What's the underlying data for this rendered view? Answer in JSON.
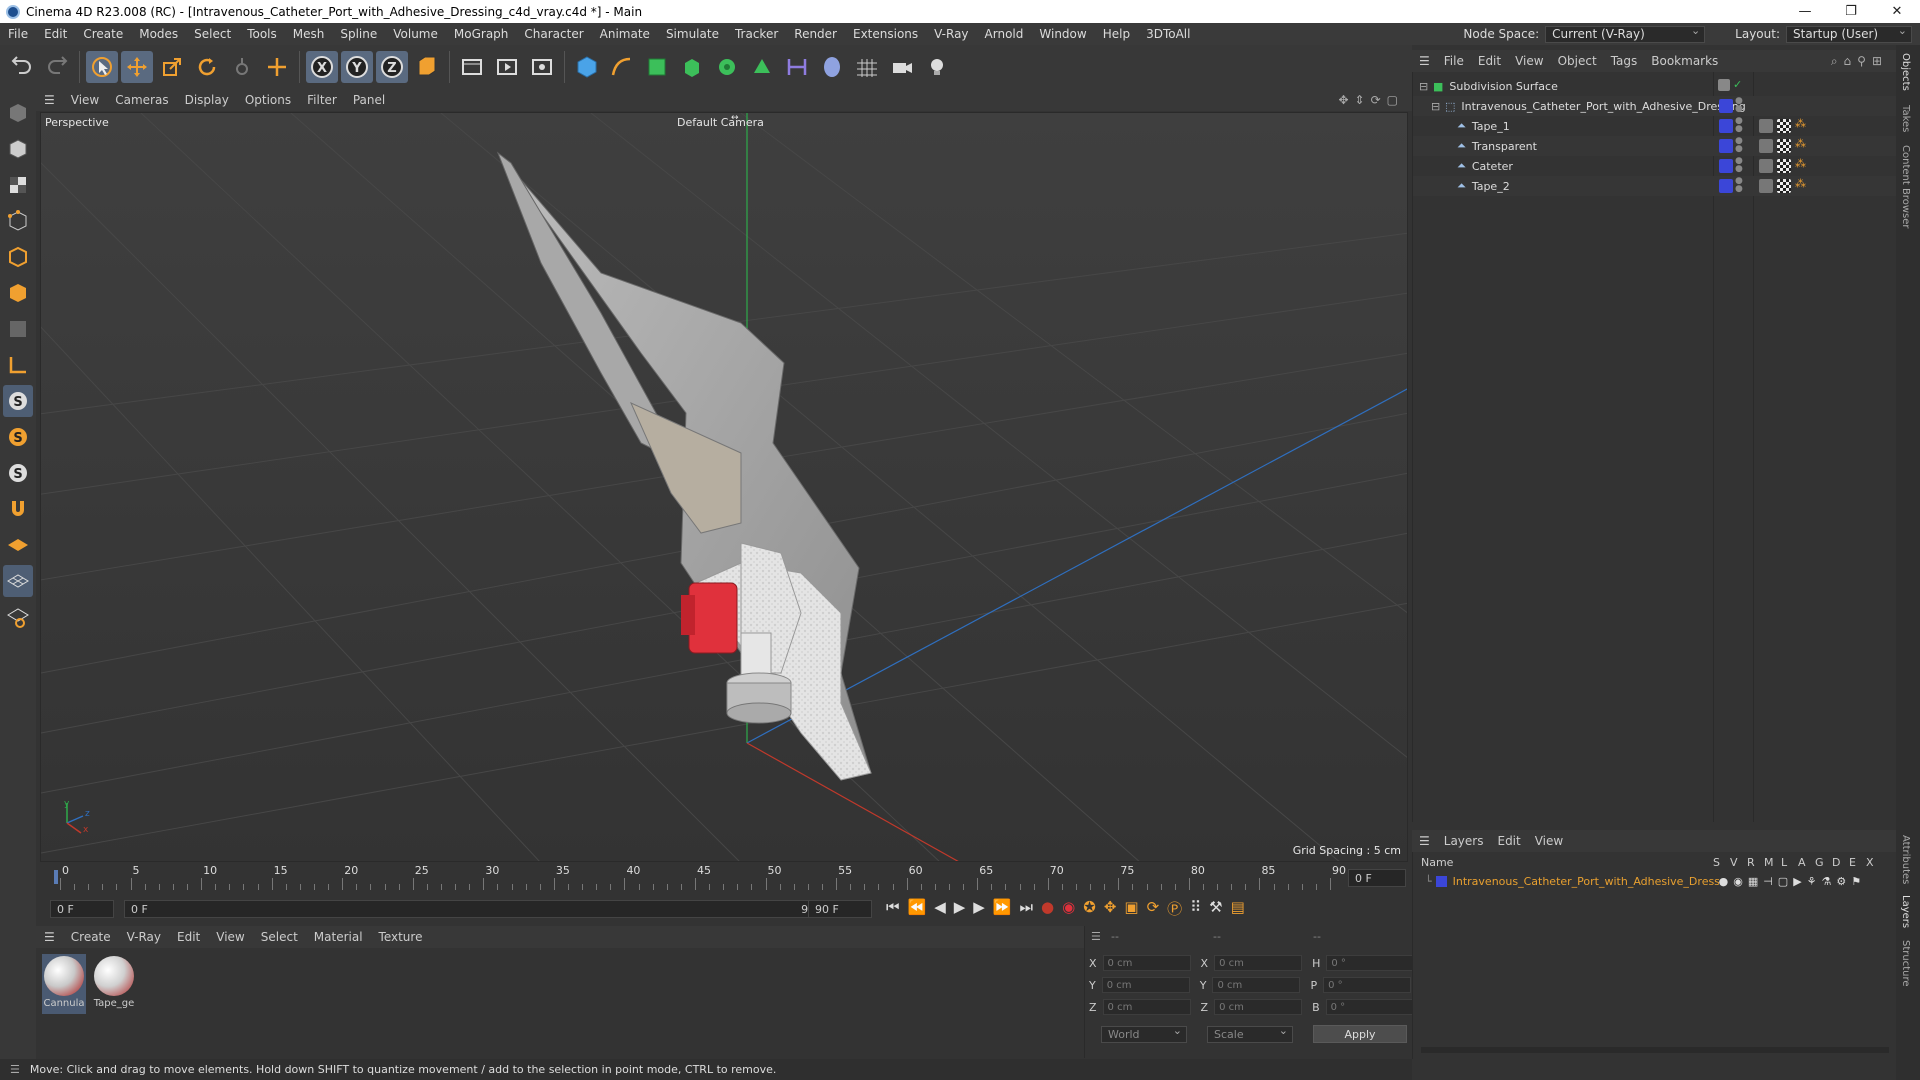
{
  "window": {
    "title": "Cinema 4D R23.008 (RC) - [Intravenous_Catheter_Port_with_Adhesive_Dressing_c4d_vray.c4d *] - Main",
    "controls": [
      "—",
      "❐",
      "✕"
    ]
  },
  "menubar": {
    "items": [
      "File",
      "Edit",
      "Create",
      "Modes",
      "Select",
      "Tools",
      "Mesh",
      "Spline",
      "Volume",
      "MoGraph",
      "Character",
      "Animate",
      "Simulate",
      "Tracker",
      "Render",
      "Extensions",
      "V-Ray",
      "Arnold",
      "Window",
      "Help",
      "3DToAll"
    ],
    "node_space_label": "Node Space:",
    "node_space_value": "Current (V-Ray)",
    "layout_label": "Layout:",
    "layout_value": "Startup (User)"
  },
  "viewport": {
    "menu": [
      "View",
      "Cameras",
      "Display",
      "Options",
      "Filter",
      "Panel"
    ],
    "view_name": "Perspective",
    "camera": "Default Camera",
    "grid_spacing": "Grid Spacing : 5 cm",
    "axis_labels": {
      "y": "y",
      "z": "z",
      "x": "x"
    }
  },
  "timeline": {
    "ticks": [
      "0",
      "5",
      "10",
      "15",
      "20",
      "25",
      "30",
      "35",
      "40",
      "45",
      "50",
      "55",
      "60",
      "65",
      "70",
      "75",
      "80",
      "85",
      "90"
    ],
    "current_frame_right": "0 F",
    "start_field": "0 F",
    "range_start": "0 F",
    "range_end": "90 F",
    "end_field": "90 F"
  },
  "material_manager": {
    "menu": [
      "Create",
      "V-Ray",
      "Edit",
      "View",
      "Select",
      "Material",
      "Texture"
    ],
    "materials": [
      {
        "name": "Cannula",
        "color": "#c9c9c9"
      },
      {
        "name": "Tape_ge",
        "color": "#d0d0d0"
      }
    ]
  },
  "coordinates": {
    "headers": [
      "--",
      "--",
      "--"
    ],
    "rows": [
      {
        "a": "X",
        "av": "0 cm",
        "b": "X",
        "bv": "0 cm",
        "c": "H",
        "cv": "0 °"
      },
      {
        "a": "Y",
        "av": "0 cm",
        "b": "Y",
        "bv": "0 cm",
        "c": "P",
        "cv": "0 °"
      },
      {
        "a": "Z",
        "av": "0 cm",
        "b": "Z",
        "bv": "0 cm",
        "c": "B",
        "cv": "0 °"
      }
    ],
    "mode1": "World",
    "mode2": "Scale",
    "apply": "Apply"
  },
  "status": {
    "text": "Move: Click and drag to move elements. Hold down SHIFT to quantize movement / add to the selection in point mode, CTRL to remove."
  },
  "object_manager": {
    "menu": [
      "File",
      "Edit",
      "View",
      "Object",
      "Tags",
      "Bookmarks"
    ],
    "objects": [
      {
        "name": "Subdivision Surface",
        "indent": 0
      },
      {
        "name": "Intravenous_Catheter_Port_with_Adhesive_Dressing",
        "indent": 1
      },
      {
        "name": "Tape_1",
        "indent": 2
      },
      {
        "name": "Transparent",
        "indent": 2
      },
      {
        "name": "Cateter",
        "indent": 2
      },
      {
        "name": "Tape_2",
        "indent": 2
      }
    ]
  },
  "layer_manager": {
    "menu": [
      "Layers",
      "Edit",
      "View"
    ],
    "columns": [
      "Name",
      "S",
      "V",
      "R",
      "M",
      "L",
      "A",
      "G",
      "D",
      "E",
      "X"
    ],
    "layer_name": "Intravenous_Catheter_Port_with_Adhesive_Dressing",
    "layer_color": "#e8a030"
  },
  "side_tabs": [
    "Objects",
    "Takes",
    "Content Browser",
    "Attributes",
    "Layers",
    "Structure"
  ],
  "colors": {
    "accent_blue": "#5a6a80",
    "layer_text": "#e8a030",
    "red_connector": "#e0313c",
    "x_axis": "#c0392b",
    "z_axis": "#2f6fbf",
    "y_axis": "#2eaa4a"
  }
}
